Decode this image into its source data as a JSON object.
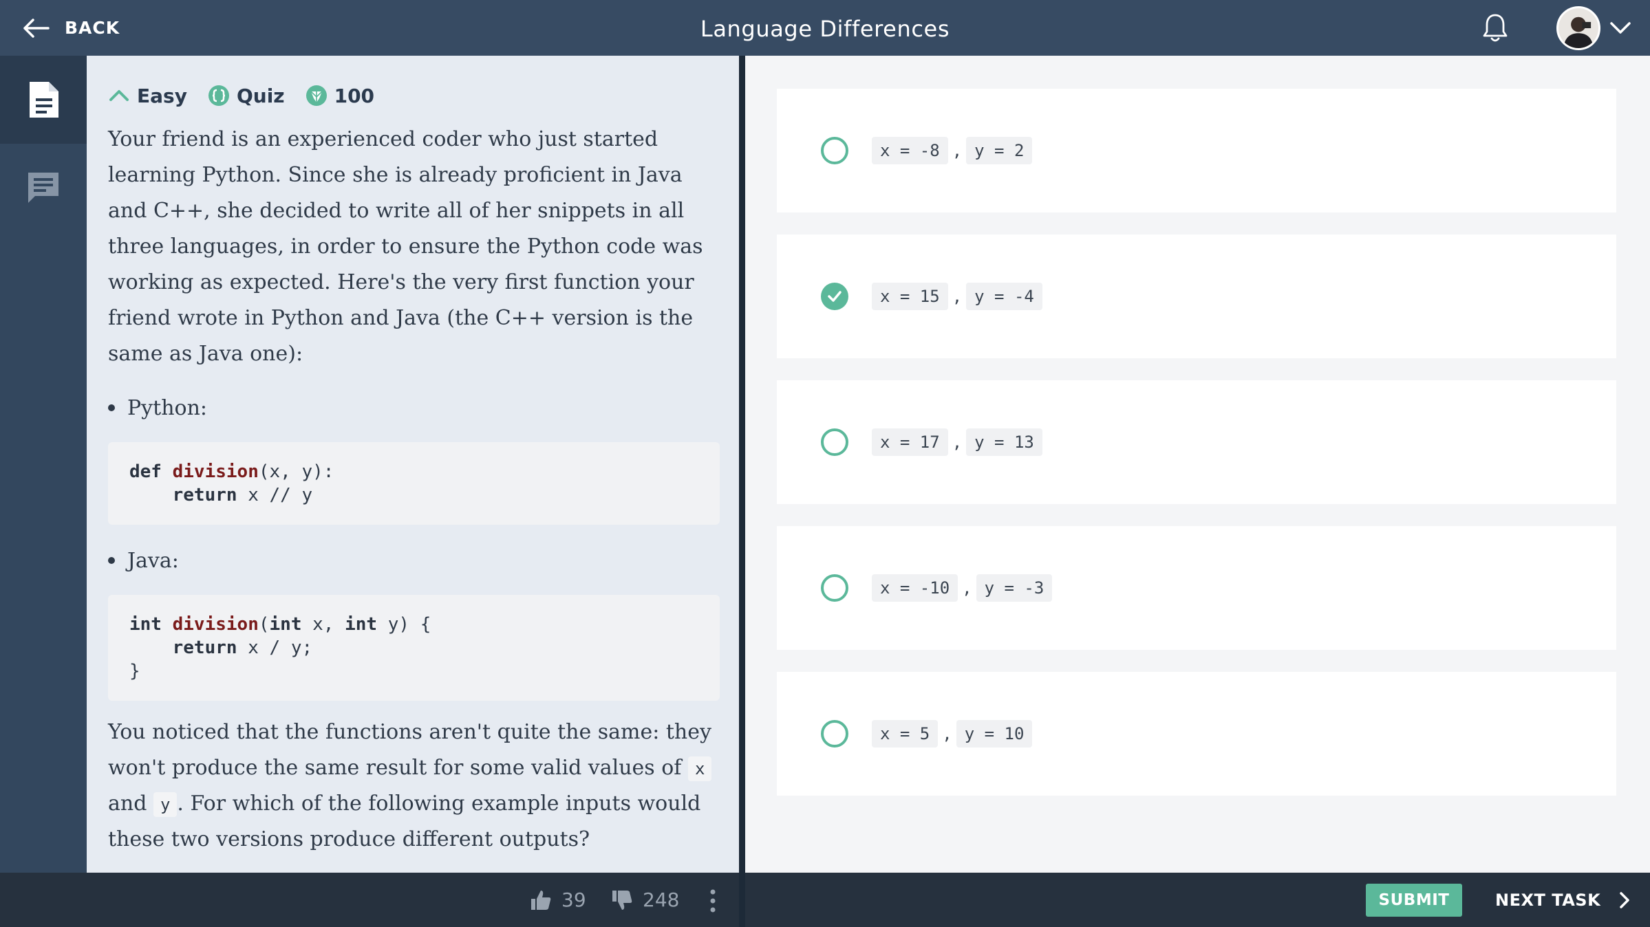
{
  "header": {
    "back_label": "BACK",
    "title": "Language Differences",
    "back_icon": "arrow-left-icon",
    "bell_icon": "bell-icon",
    "menu_icon": "chevron-down-icon"
  },
  "leftnav": {
    "items": [
      {
        "icon": "document-icon",
        "active": true
      },
      {
        "icon": "comments-icon",
        "active": false
      }
    ]
  },
  "task": {
    "difficulty": "Easy",
    "type": "Quiz",
    "points": "100",
    "intro": "Your friend is an experienced coder who just started learning Python. Since she is already proficient in Java and C++, she decided to write all of her snippets in all three languages, in order to ensure the Python code was working as expected. Here's the very first function your friend wrote in Python and Java (the C++ version is the same as Java one):",
    "bullet_python": "Python:",
    "bullet_java": "Java:",
    "python_code": {
      "l1_kw": "def",
      "l1_fn": "division",
      "l1_rest": "(x, y):",
      "l2_indent": "    ",
      "l2_kw": "return",
      "l2_rest": " x // y"
    },
    "java_code": {
      "l1_kw1": "int",
      "l1_fn": "division",
      "l1_mid1": "(",
      "l1_kw2": "int",
      "l1_mid2": " x, ",
      "l1_kw3": "int",
      "l1_end": " y) {",
      "l2_indent": "    ",
      "l2_kw": "return",
      "l2_rest": " x / y;",
      "l3": "}"
    },
    "outro_1": "You noticed that the functions aren't quite the same: they won't produce the same result for some valid values of",
    "outro_x": "x",
    "outro_and": "and",
    "outro_y": "y",
    "outro_2": ". For which of the following example inputs would these two versions produce different outputs?"
  },
  "options": [
    {
      "x": "x = -8",
      "y": "y = 2",
      "checked": false
    },
    {
      "x": "x = 15",
      "y": "y = -4",
      "checked": true
    },
    {
      "x": "x = 17",
      "y": "y = 13",
      "checked": false
    },
    {
      "x": "x = -10",
      "y": "y = -3",
      "checked": false
    },
    {
      "x": "x = 5",
      "y": "y = 10",
      "checked": false
    }
  ],
  "option_separator": ",",
  "footer": {
    "likes": "39",
    "dislikes": "248",
    "submit": "SUBMIT",
    "next": "NEXT TASK"
  },
  "colors": {
    "header_bg": "#374b63",
    "accent": "#5bb89a",
    "footer_bg": "#26313e"
  }
}
